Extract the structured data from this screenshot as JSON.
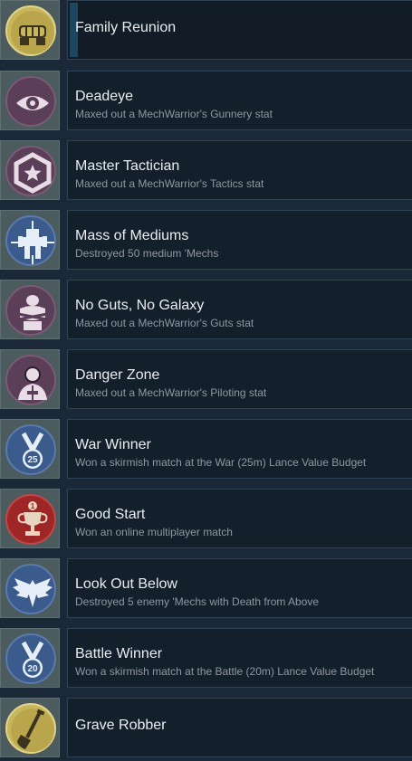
{
  "achievements": [
    {
      "title": "Family Reunion",
      "description": "",
      "icon": "clasped-fists-icon",
      "badge_color": "#c8b65c"
    },
    {
      "title": "Deadeye",
      "description": "Maxed out a MechWarrior's Gunnery stat",
      "icon": "eye-icon",
      "badge_color": "#5b3e58"
    },
    {
      "title": "Master Tactician",
      "description": "Maxed out a MechWarrior's Tactics stat",
      "icon": "star-emblem-icon",
      "badge_color": "#5b3e58"
    },
    {
      "title": "Mass of Mediums",
      "description": "Destroyed 50 medium 'Mechs",
      "icon": "mech-target-icon",
      "badge_color": "#3b5b8c"
    },
    {
      "title": "No Guts, No Galaxy",
      "description": "Maxed out a MechWarrior's Guts stat",
      "icon": "crossed-arms-icon",
      "badge_color": "#5b3e58"
    },
    {
      "title": "Danger Zone",
      "description": "Maxed out a MechWarrior's Piloting stat",
      "icon": "pilot-icon",
      "badge_color": "#5b3e58"
    },
    {
      "title": "War Winner",
      "description": "Won a skirmish match at the War (25m) Lance Value Budget",
      "icon": "medal-25-icon",
      "badge_color": "#3b5b8c"
    },
    {
      "title": "Good Start",
      "description": "Won an online multiplayer match",
      "icon": "trophy-icon",
      "badge_color": "#9e2626"
    },
    {
      "title": "Look Out Below",
      "description": "Destroyed 5 enemy 'Mechs with Death from Above",
      "icon": "winged-emblem-icon",
      "badge_color": "#3b5b8c"
    },
    {
      "title": "Battle Winner",
      "description": "Won a skirmish match at the Battle (20m) Lance Value Budget",
      "icon": "medal-20-icon",
      "badge_color": "#3b5b8c"
    },
    {
      "title": "Grave Robber",
      "description": "",
      "icon": "shovel-icon",
      "badge_color": "#c8b65c"
    }
  ],
  "medal_numbers": {
    "war": "25",
    "battle": "20",
    "good_start": "1"
  }
}
